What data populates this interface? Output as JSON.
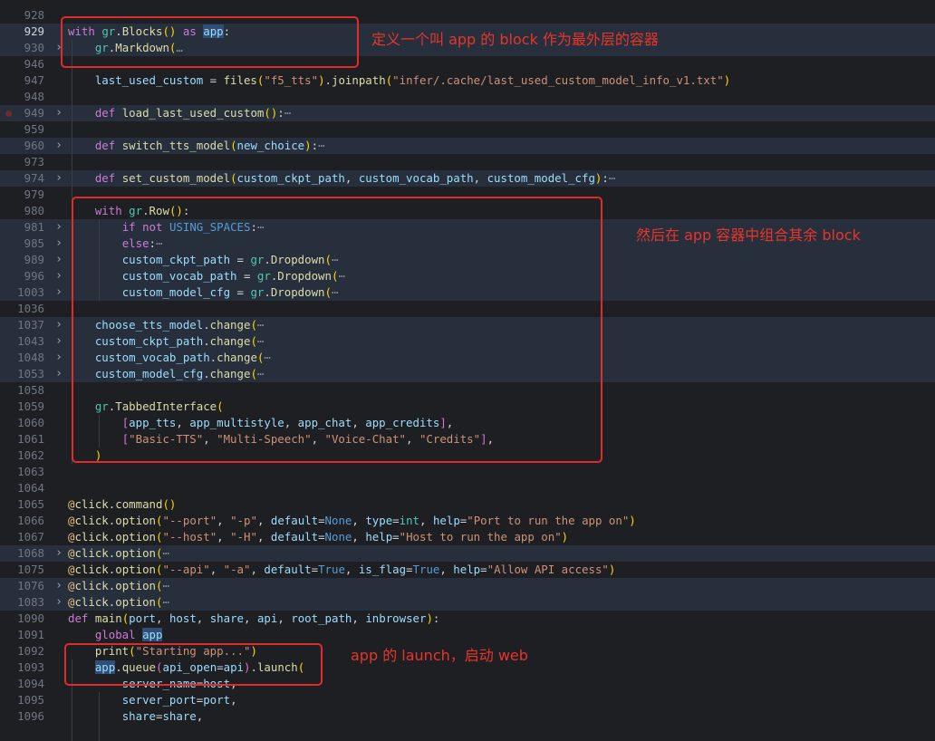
{
  "editor": {
    "lines": [
      {
        "n": "928",
        "html": ""
      },
      {
        "n": "929",
        "cur": true,
        "hl": true,
        "html": "<span class='kw'>with</span> <span class='cls'>gr</span>.<span class='fn2'>Blocks</span><span class='par'>()</span> <span class='kw'>as</span> <span class='appbg'>app</span>:"
      },
      {
        "n": "930",
        "fold": true,
        "hl": true,
        "html": "    <span class='cls'>gr</span>.<span class='fn2'>Markdown</span><span class='par'>(</span><span class='dim'>…</span>"
      },
      {
        "n": "946",
        "html": ""
      },
      {
        "n": "947",
        "html": "    <span class='var'>last_used_custom</span> = <span class='fn2'>files</span><span class='par'>(</span><span class='str'>\"f5_tts\"</span><span class='par'>)</span>.<span class='fn2'>joinpath</span><span class='par'>(</span><span class='str'>\"infer/.cache/last_used_custom_model_info_v1.txt\"</span><span class='par'>)</span>"
      },
      {
        "n": "948",
        "html": ""
      },
      {
        "n": "949",
        "fold": true,
        "hl": true,
        "bp": true,
        "html": "    <span class='kw'>def</span> <span class='fn2'>load_last_used_custom</span><span class='par'>()</span>:<span class='dim'>⋯</span>"
      },
      {
        "n": "959",
        "html": ""
      },
      {
        "n": "960",
        "fold": true,
        "hl": true,
        "html": "    <span class='kw'>def</span> <span class='fn2'>switch_tts_model</span><span class='par'>(</span><span class='var'>new_choice</span><span class='par'>)</span>:<span class='dim'>⋯</span>"
      },
      {
        "n": "973",
        "html": ""
      },
      {
        "n": "974",
        "fold": true,
        "hl": true,
        "html": "    <span class='kw'>def</span> <span class='fn2'>set_custom_model</span><span class='par'>(</span><span class='var'>custom_ckpt_path</span>, <span class='var'>custom_vocab_path</span>, <span class='var'>custom_model_cfg</span><span class='par'>)</span>:<span class='dim'>⋯</span>"
      },
      {
        "n": "979",
        "html": ""
      },
      {
        "n": "980",
        "html": "    <span class='kw'>with</span> <span class='cls'>gr</span>.<span class='fn2'>Row</span><span class='par'>()</span>:"
      },
      {
        "n": "981",
        "fold": true,
        "hl": true,
        "html": "        <span class='kw'>if</span> <span class='kw'>not</span> <span class='const'>USING_SPACES</span>:<span class='dim'>⋯</span>"
      },
      {
        "n": "985",
        "fold": true,
        "hl": true,
        "html": "        <span class='kw'>else</span>:<span class='dim'>⋯</span>"
      },
      {
        "n": "989",
        "fold": true,
        "hl": true,
        "html": "        <span class='var'>custom_ckpt_path</span> = <span class='cls'>gr</span>.<span class='fn2'>Dropdown</span><span class='par'>(</span><span class='dim'>⋯</span>"
      },
      {
        "n": "996",
        "fold": true,
        "hl": true,
        "html": "        <span class='var'>custom_vocab_path</span> = <span class='cls'>gr</span>.<span class='fn2'>Dropdown</span><span class='par'>(</span><span class='dim'>⋯</span>"
      },
      {
        "n": "1003",
        "fold": true,
        "hl": true,
        "html": "        <span class='var'>custom_model_cfg</span> = <span class='cls'>gr</span>.<span class='fn2'>Dropdown</span><span class='par'>(</span><span class='dim'>⋯</span>"
      },
      {
        "n": "1036",
        "html": ""
      },
      {
        "n": "1037",
        "fold": true,
        "hl": true,
        "html": "    <span class='var'>choose_tts_model</span>.<span class='fn2'>change</span><span class='par'>(</span><span class='dim'>⋯</span>"
      },
      {
        "n": "1043",
        "fold": true,
        "hl": true,
        "html": "    <span class='var'>custom_ckpt_path</span>.<span class='fn2'>change</span><span class='par'>(</span><span class='dim'>⋯</span>"
      },
      {
        "n": "1048",
        "fold": true,
        "hl": true,
        "html": "    <span class='var'>custom_vocab_path</span>.<span class='fn2'>change</span><span class='par'>(</span><span class='dim'>⋯</span>"
      },
      {
        "n": "1053",
        "fold": true,
        "hl": true,
        "html": "    <span class='var'>custom_model_cfg</span>.<span class='fn2'>change</span><span class='par'>(</span><span class='dim'>⋯</span>"
      },
      {
        "n": "1058",
        "html": ""
      },
      {
        "n": "1059",
        "html": "    <span class='cls'>gr</span>.<span class='fn2'>TabbedInterface</span><span class='par'>(</span>"
      },
      {
        "n": "1060",
        "html": "        <span class='par2'>[</span><span class='var'>app_tts</span>, <span class='var'>app_multistyle</span>, <span class='var'>app_chat</span>, <span class='var'>app_credits</span><span class='par2'>]</span>,"
      },
      {
        "n": "1061",
        "html": "        <span class='par2'>[</span><span class='str'>\"Basic-TTS\"</span>, <span class='str'>\"Multi-Speech\"</span>, <span class='str'>\"Voice-Chat\"</span>, <span class='str'>\"Credits\"</span><span class='par2'>]</span>,"
      },
      {
        "n": "1062",
        "html": "    <span class='par'>)</span>"
      },
      {
        "n": "1063",
        "html": ""
      },
      {
        "n": "1064",
        "html": ""
      },
      {
        "n": "1065",
        "html": "<span class='dec'>@</span><span class='fn2'>click</span>.<span class='fn2'>command</span><span class='par'>()</span>"
      },
      {
        "n": "1066",
        "html": "<span class='dec'>@</span><span class='fn2'>click</span>.<span class='fn2'>option</span><span class='par'>(</span><span class='str'>\"--port\"</span>, <span class='str'>\"-p\"</span>, <span class='var'>default</span>=<span class='const'>None</span>, <span class='var'>type</span>=<span class='cls'>int</span>, <span class='var'>help</span>=<span class='str'>\"Port to run the app on\"</span><span class='par'>)</span>"
      },
      {
        "n": "1067",
        "html": "<span class='dec'>@</span><span class='fn2'>click</span>.<span class='fn2'>option</span><span class='par'>(</span><span class='str'>\"--host\"</span>, <span class='str'>\"-H\"</span>, <span class='var'>default</span>=<span class='const'>None</span>, <span class='var'>help</span>=<span class='str'>\"Host to run the app on\"</span><span class='par'>)</span>"
      },
      {
        "n": "1068",
        "fold": true,
        "hl": true,
        "html": "<span class='dec'>@</span><span class='fn2'>click</span>.<span class='fn2'>option</span><span class='par'>(</span><span class='dim'>⋯</span>"
      },
      {
        "n": "1075",
        "html": "<span class='dec'>@</span><span class='fn2'>click</span>.<span class='fn2'>option</span><span class='par'>(</span><span class='str'>\"--api\"</span>, <span class='str'>\"-a\"</span>, <span class='var'>default</span>=<span class='const'>True</span>, <span class='var'>is_flag</span>=<span class='const'>True</span>, <span class='var'>help</span>=<span class='str'>\"Allow API access\"</span><span class='par'>)</span>"
      },
      {
        "n": "1076",
        "fold": true,
        "hl": true,
        "html": "<span class='dec'>@</span><span class='fn2'>click</span>.<span class='fn2'>option</span><span class='par'>(</span><span class='dim'>⋯</span>"
      },
      {
        "n": "1083",
        "fold": true,
        "hl": true,
        "html": "<span class='dec'>@</span><span class='fn2'>click</span>.<span class='fn2'>option</span><span class='par'>(</span><span class='dim'>⋯</span>"
      },
      {
        "n": "1090",
        "html": "<span class='kw'>def</span> <span class='fn2'>main</span><span class='par'>(</span><span class='var'>port</span>, <span class='var'>host</span>, <span class='var'>share</span>, <span class='var'>api</span>, <span class='var'>root_path</span>, <span class='var'>inbrowser</span><span class='par'>)</span>:"
      },
      {
        "n": "1091",
        "html": "    <span class='kw'>global</span> <span class='appbg'>app</span>"
      },
      {
        "n": "1092",
        "html": "    <span class='fn2'>print</span><span class='par'>(</span><span class='str'>\"Starting app...\"</span><span class='par'>)</span>"
      },
      {
        "n": "1093",
        "html": "    <span class='appbg'>app</span>.<span class='fn2'>queue</span><span class='par2'>(</span><span class='var'>api_open</span>=<span class='var'>api</span><span class='par2'>)</span>.<span class='fn2'>launch</span><span class='par'>(</span>"
      },
      {
        "n": "1094",
        "html": "        <span class='var'>server_name</span>=<span class='var'>host</span>,"
      },
      {
        "n": "1095",
        "html": "        <span class='var'>server_port</span>=<span class='var'>port</span>,"
      },
      {
        "n": "1096",
        "html": "        <span class='var'>share</span>=<span class='var'>share</span>,"
      }
    ]
  },
  "annotations": {
    "a1": "定义一个叫 app 的 block 作为最外层的容器",
    "a2": "然后在 app 容器中组合其余 block",
    "a3": "app 的 launch，启动 web"
  }
}
